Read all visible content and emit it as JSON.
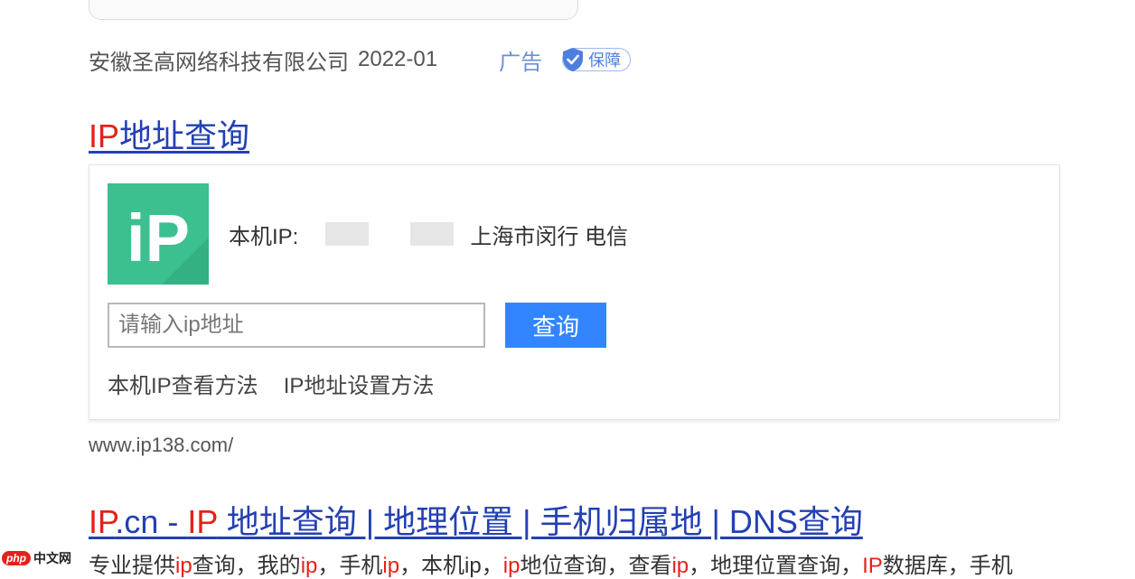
{
  "ad": {
    "company": "安徽圣高网络科技有限公司",
    "date": "2022-01",
    "label": "广告",
    "guarantee": "保障"
  },
  "result1": {
    "title_hl": "IP",
    "title_rest": "地址查询",
    "my_ip_label": "本机IP:",
    "location": "上海市闵行 电信",
    "input_placeholder": "请输入ip地址",
    "query_button": "查询",
    "links": [
      "本机IP查看方法",
      "IP地址设置方法"
    ],
    "url": "www.ip138.com/"
  },
  "result2": {
    "title_parts": [
      "IP",
      ".cn - ",
      "IP",
      " 地址查询 | 地理位置 | 手机归属地 | DNS查询"
    ],
    "snippet_parts": [
      "专业提供",
      "ip",
      "查询，我的",
      "ip",
      "，手机",
      "ip",
      "，本机ip，",
      "ip",
      "地位查询，查看",
      "ip",
      "，地理位置查询，",
      "IP",
      "数据库，手机"
    ]
  },
  "watermark": {
    "logo": "php",
    "text": "中文网"
  },
  "colors": {
    "link": "#2440b3",
    "highlight": "#e2231a",
    "button": "#3385ff",
    "logo_green": "#3cc08f"
  }
}
